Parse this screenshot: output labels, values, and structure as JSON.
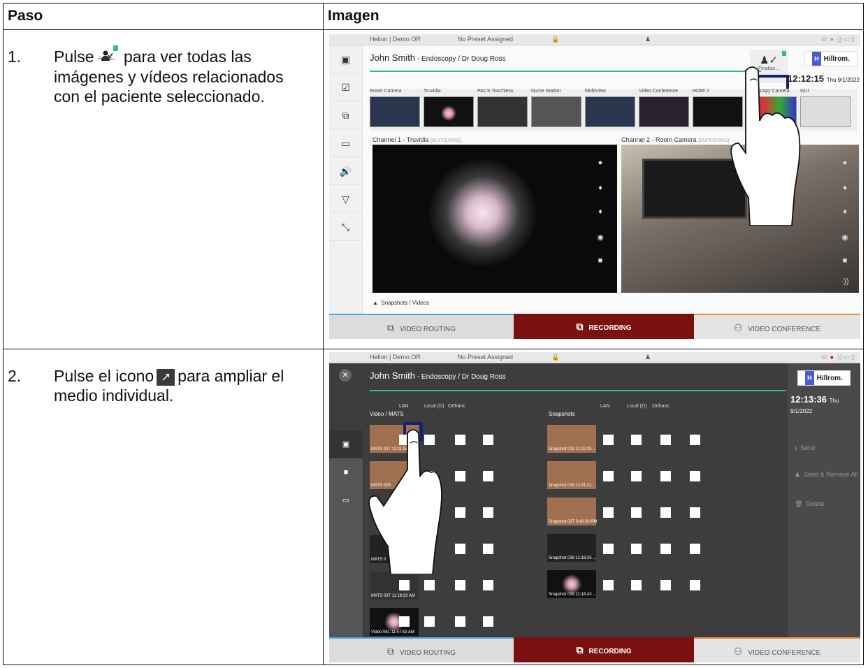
{
  "table": {
    "header_paso": "Paso",
    "header_imagen": "Imagen"
  },
  "step1": {
    "number": "1.",
    "text_before": "Pulse",
    "text_after": "para ver todas las imágenes y vídeos relacionados con el paciente seleccionado.",
    "inline_icon": "finalize-patient-icon",
    "inline_icon_caption": "Finalize...",
    "screen": {
      "org": "Helion | Demo OR",
      "preset": "No Preset Assigned",
      "patient_name": "John Smith",
      "patient_detail": " - Endoscopy / Dr Doug Ross",
      "finalize_label": "Finalize...",
      "brand": "Hillrom.",
      "brand_mark": "H",
      "time": "12:12:15",
      "date": "Thu 9/1/2022",
      "sources": [
        "Room Camera",
        "Truvidia",
        "PACS Touchless",
        "Nurse Station",
        "MultiView",
        "Video Conference",
        "HDMI 2",
        "Endoscopy Camera",
        "GUI"
      ],
      "channel1": "Channel 1 - Truvidia",
      "channel2": "Channel 2 - Room Camera",
      "buffering": "[BUFFERING]",
      "snapshots_label": "Snapshots / Videos",
      "tab_routing": "VIDEO ROUTING",
      "tab_recording": "RECORDING",
      "tab_conference": "VIDEO CONFERENCE"
    }
  },
  "step2": {
    "number": "2.",
    "text_before": "Pulse el icono",
    "text_after": "para ampliar el medio individual.",
    "inline_icon": "expand-arrow-icon",
    "inline_icon_glyph": "↗",
    "screen": {
      "org": "Helion | Demo OR",
      "preset": "No Preset Assigned",
      "patient_name": "John Smith",
      "patient_detail": " - Endoscopy / Dr Doug Ross",
      "brand": "Hillrom.",
      "brand_mark": "H",
      "time": "12:13:36",
      "date": "Thu 9/1/2022",
      "col_video": "Video / MATS",
      "col_snapshots": "Snapshots",
      "dest_lan": "LAN",
      "dest_local": "Local (D)",
      "dest_orthanc": "Orthanc",
      "video_items": [
        "MATS 027 11:31:55",
        "MATS 028",
        "MATS 0",
        "MATS 037 11:18:33 AM",
        "Video 061 11:57:53 AM"
      ],
      "snapshot_items": [
        "Snapshot 028 11:32:25 ...",
        "Snapshot 029 11:41:21 ...",
        "Snapshot 037 3:43:30 PM",
        "Snapshot 038 11:18:25 ...",
        "Snapshot 039 11:18:43 ..."
      ],
      "menu_send": "Send",
      "menu_send_remove": "Send & Remove All",
      "menu_delete": "Delete",
      "tab_routing": "VIDEO ROUTING",
      "tab_recording": "RECORDING",
      "tab_conference": "VIDEO CONFERENCE"
    }
  },
  "colors": {
    "border": "#111111",
    "teal": "#2eb8a0",
    "recording_tab": "#7a1010",
    "highlight": "#14226e"
  }
}
